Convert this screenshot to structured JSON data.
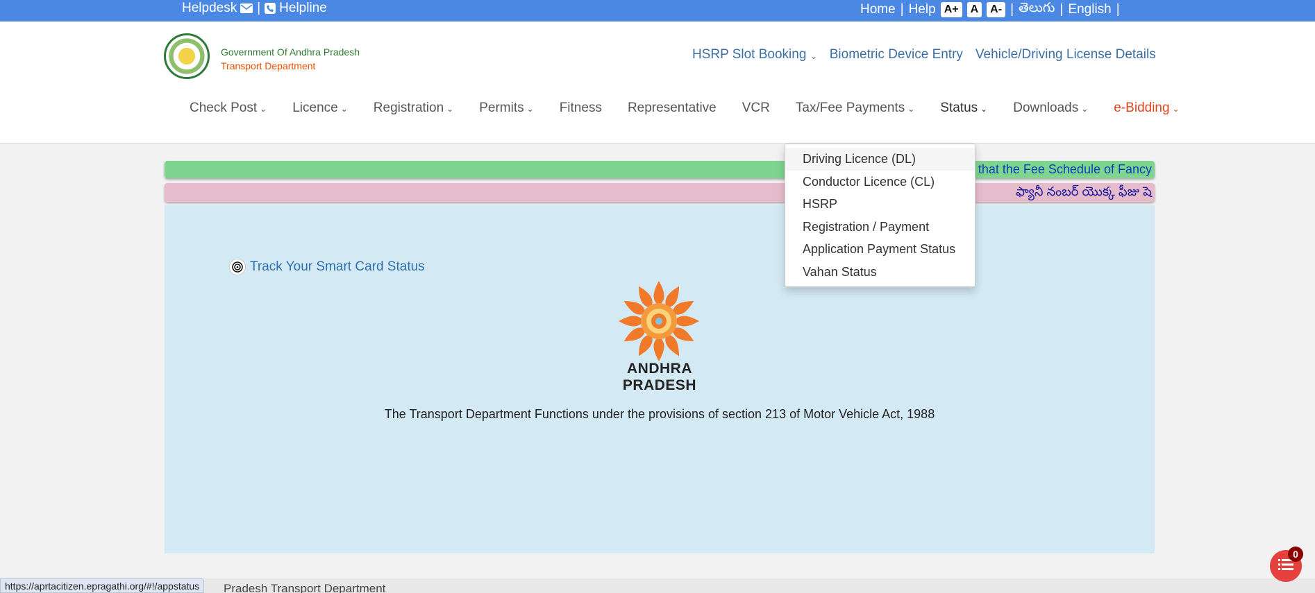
{
  "topbar": {
    "helpdesk": "Helpdesk",
    "sep1": "|",
    "helpline": "Helpline",
    "home": "Home",
    "help": "Help",
    "font_increase": "A+",
    "font_normal": "A",
    "font_decrease": "A-",
    "telugu": "తెలుగు",
    "english": "English",
    "pipe": "|"
  },
  "header": {
    "gov_line1": "Government Of Andhra Pradesh",
    "gov_line2": "Transport Department",
    "top_links": {
      "hsrp": "HSRP Slot Booking",
      "biometric": "Biometric Device Entry",
      "vehicle_dl": "Vehicle/Driving License Details"
    },
    "nav": {
      "checkpost": "Check Post",
      "licence": "Licence",
      "registration": "Registration",
      "permits": "Permits",
      "fitness": "Fitness",
      "representative": "Representative",
      "vcr": "VCR",
      "taxfee": "Tax/Fee Payments",
      "status": "Status",
      "downloads": "Downloads",
      "ebidding": "e-Bidding"
    }
  },
  "marquee": {
    "english": "e that the Fee Schedule of Fancy",
    "telugu": "ఫ్యానీ నంబర్ యొక్క ఫీజు షె"
  },
  "main": {
    "track_link": "Track Your Smart Card Status",
    "state_name": "ANDHRA PRADESH",
    "description": "The Transport Department Functions under the provisions of section 213 of Motor Vehicle Act, 1988"
  },
  "status_dropdown": {
    "items": [
      "Driving Licence (DL)",
      "Conductor Licence (CL)",
      "HSRP",
      "Registration / Payment",
      "Application Payment Status",
      "Vahan Status"
    ]
  },
  "footer": {
    "text": "Pradesh Transport Department"
  },
  "status_url": "https://aprtacitizen.epragathi.org/#!/appstatus",
  "notification_count": "0",
  "colors": {
    "topbar": "#4a88e3",
    "accent_orange": "#e2461c",
    "panel": "#d3e9f4"
  }
}
